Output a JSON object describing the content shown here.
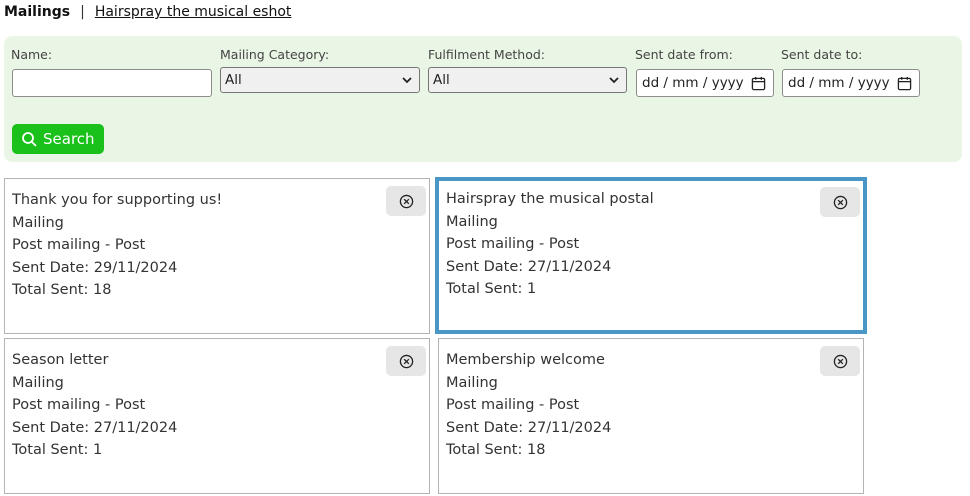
{
  "breadcrumb": {
    "root": "Mailings",
    "separator": "|",
    "current": "Hairspray the musical eshot"
  },
  "filters": {
    "name_label": "Name:",
    "name_value": "",
    "category_label": "Mailing Category:",
    "category_value": "All",
    "fulfilment_label": "Fulfilment Method:",
    "fulfilment_value": "All",
    "sent_from_label": "Sent date from:",
    "sent_from_value": "dd / mm / yyyy",
    "sent_to_label": "Sent date to:",
    "sent_to_value": "dd / mm / yyyy",
    "search_label": "Search"
  },
  "cards": [
    {
      "title": "Thank you for supporting us!",
      "type": "Mailing",
      "method": "Post mailing - Post",
      "sent_date": "Sent Date: 29/11/2024",
      "total_sent": "Total Sent: 18",
      "selected": false
    },
    {
      "title": "Hairspray the musical postal",
      "type": "Mailing",
      "method": "Post mailing - Post",
      "sent_date": "Sent Date: 27/11/2024",
      "total_sent": "Total Sent: 1",
      "selected": true
    },
    {
      "title": "Season letter",
      "type": "Mailing",
      "method": "Post mailing - Post",
      "sent_date": "Sent Date: 27/11/2024",
      "total_sent": "Total Sent: 1",
      "selected": false
    },
    {
      "title": "Membership welcome",
      "type": "Mailing",
      "method": "Post mailing - Post",
      "sent_date": "Sent Date: 27/11/2024",
      "total_sent": "Total Sent: 18",
      "selected": false
    }
  ],
  "icons": {
    "search": "search-icon",
    "remove": "circle-x-icon",
    "calendar": "calendar-icon",
    "dropdown": "chevron-down-icon"
  },
  "colors": {
    "panel_bg": "#eaf6e5",
    "search_button": "#1ac11a",
    "selected_border": "#4a97c7"
  }
}
